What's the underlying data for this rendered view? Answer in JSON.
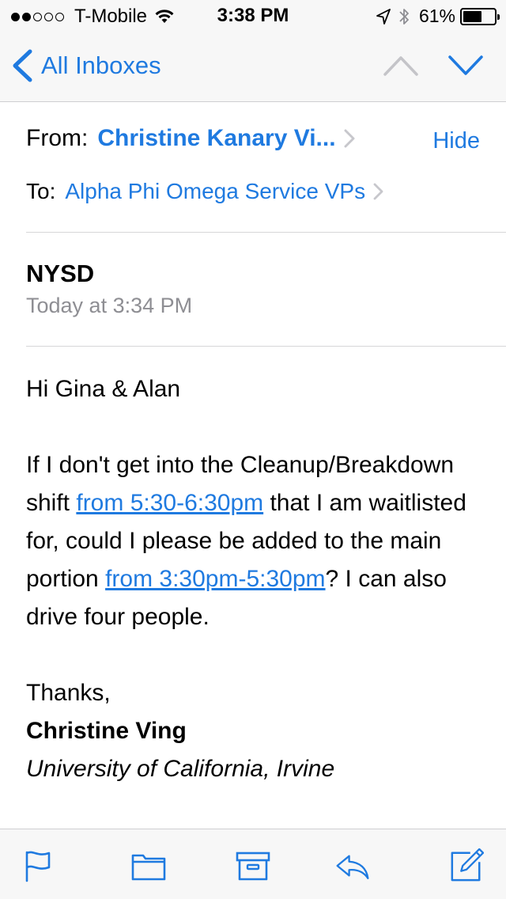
{
  "status_bar": {
    "carrier": "T-Mobile",
    "time": "3:38 PM",
    "battery_percent_label": "61%",
    "battery_level": 0.61,
    "signal_bars_filled": 2,
    "signal_bars_total": 5
  },
  "nav": {
    "back_label": "All Inboxes",
    "icons": [
      "chevron-left-icon",
      "chevron-up-icon",
      "chevron-down-icon"
    ]
  },
  "header": {
    "from_label": "From:",
    "from_name": "Christine Kanary Vi...",
    "hide_label": "Hide",
    "to_label": "To:",
    "to_name": "Alpha Phi Omega Service VPs"
  },
  "message": {
    "subject": "NYSD",
    "date": "Today at 3:34 PM",
    "greeting": "Hi Gina & Alan",
    "para_part1": "If I don't get into the Cleanup/Breakdown shift ",
    "link1": "from 5:30-6:30pm",
    "para_part2": " that I am waitlisted for, could I please be added to the main portion ",
    "link2": "from 3:30pm-5:30pm",
    "para_part3": "? I can also drive four people.",
    "signoff": "Thanks,",
    "signature_name": "Christine Ving",
    "signature_org": "University of California, Irvine"
  },
  "toolbar": {
    "icons": [
      "flag-icon",
      "folder-icon",
      "archive-icon",
      "reply-icon",
      "compose-icon"
    ]
  },
  "colors": {
    "accent": "#1f7ae0",
    "bar_background": "#f7f7f7",
    "secondary_text": "#8e8e93",
    "divider": "#d6d6d8"
  }
}
